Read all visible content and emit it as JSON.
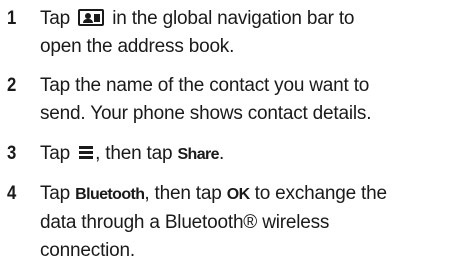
{
  "steps": [
    {
      "number": "1",
      "line1_before": "Tap",
      "line1_icon": "contacts-icon",
      "line1_after": "in the global navigation bar to",
      "line2": "open the address book."
    },
    {
      "number": "2",
      "line1": "Tap the name of the contact you want to",
      "line2": "send. Your phone shows contact details."
    },
    {
      "number": "3",
      "before": "Tap",
      "icon": "menu-icon",
      "middle": ", then tap",
      "bold": "Share",
      "after": "."
    },
    {
      "number": "4",
      "line1_before": "Tap",
      "line1_bold1": "Bluetooth",
      "line1_middle": ", then tap",
      "line1_bold2": "OK",
      "line1_after": "to exchange the",
      "line2": "data through a Bluetooth® wireless",
      "line3": "connection."
    }
  ]
}
